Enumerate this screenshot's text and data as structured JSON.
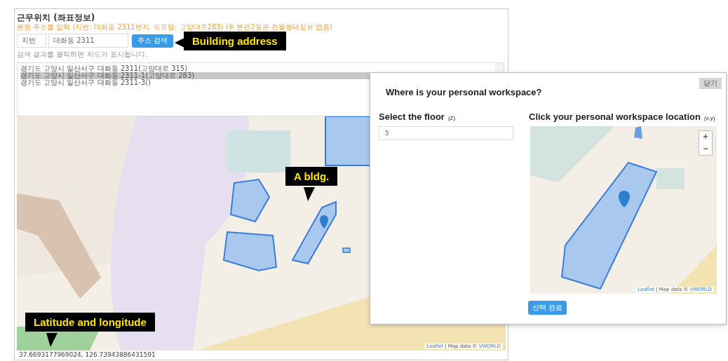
{
  "panel": {
    "title": "근무위치 (좌표정보)",
    "note": "본원 주소를 입력 (지번: 대화동 2311번지, 도로명: 고양대로283) (※ 본관2동은 건물형태정보 없음)",
    "address_type": "지번",
    "address_value": "대화동 2311",
    "search_button": "주소 검색",
    "hint": "검색 결과를 클릭하면 지도가 표시됩니다.",
    "results": [
      {
        "label": "경기도 고양시 일산서구 대화동 2311(고양대로 315)",
        "selected": false
      },
      {
        "label": "경기도 고양시 일산서구 대화동 2311-1(고양대로 283)",
        "selected": true
      },
      {
        "label": "경기도 고양시 일산서구 대화동 2311-3()",
        "selected": false
      }
    ],
    "map": {
      "kind": "picture",
      "attribution_leaflet": "Leaflet",
      "attribution_text": "| Map data ©",
      "attribution_link": "VWORLD"
    },
    "coordinates": "37.6693177969024, 126.73943886431591"
  },
  "callouts": [
    {
      "text": "Building address",
      "kind": "left"
    },
    {
      "text": "A bldg.",
      "kind": "down"
    },
    {
      "text": "Latitude and longitude",
      "kind": "down"
    }
  ],
  "dialog": {
    "close_button": "닫기",
    "title": "Where is your personal workspace?",
    "floor_label": "Select the floor",
    "floor_hint": "(Z)",
    "floor_value": "5",
    "location_label": "Click your personal workspace location",
    "location_hint": "(x,y)",
    "zoom_in": "+",
    "zoom_out": "−",
    "map": {
      "kind": "picture",
      "attribution_leaflet": "Leaflet",
      "attribution_text": "| Map data ©",
      "attribution_link": "VWORLD"
    },
    "done_button": "선택 완료"
  }
}
